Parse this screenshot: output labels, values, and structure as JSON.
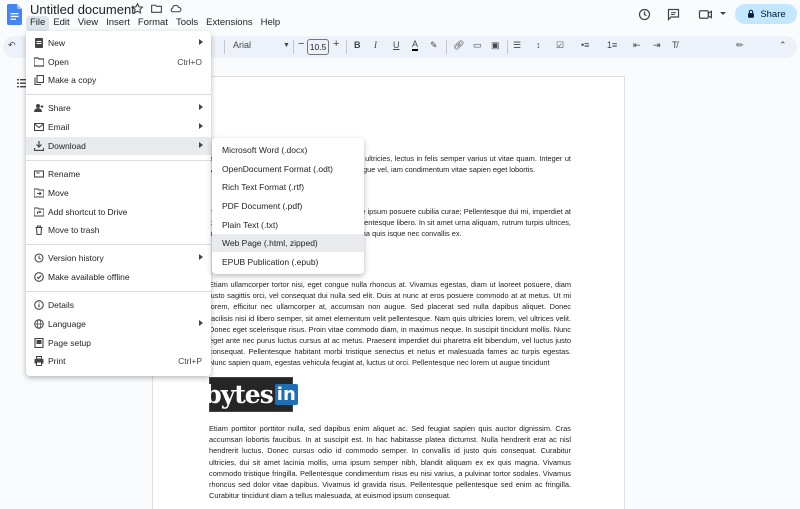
{
  "title": "Untitled document",
  "menu": [
    "File",
    "Edit",
    "View",
    "Insert",
    "Format",
    "Tools",
    "Extensions",
    "Help"
  ],
  "share_label": "Share",
  "toolbar": {
    "font": "Arial",
    "size": "10.5"
  },
  "file_menu": [
    {
      "label": "New",
      "icon": "new-doc-icon",
      "submenu": true,
      "shortcut": ""
    },
    {
      "label": "Open",
      "icon": "folder-icon",
      "submenu": false,
      "shortcut": "Ctrl+O"
    },
    {
      "label": "Make a copy",
      "icon": "copy-icon",
      "submenu": false,
      "shortcut": ""
    },
    {
      "label": "Share",
      "icon": "share-person-icon",
      "submenu": true,
      "shortcut": ""
    },
    {
      "label": "Email",
      "icon": "email-icon",
      "submenu": true,
      "shortcut": ""
    },
    {
      "label": "Download",
      "icon": "download-icon",
      "submenu": true,
      "shortcut": ""
    },
    {
      "label": "Rename",
      "icon": "rename-icon",
      "submenu": false,
      "shortcut": ""
    },
    {
      "label": "Move",
      "icon": "move-icon",
      "submenu": false,
      "shortcut": ""
    },
    {
      "label": "Add shortcut to Drive",
      "icon": "drive-shortcut-icon",
      "submenu": false,
      "shortcut": ""
    },
    {
      "label": "Move to trash",
      "icon": "trash-icon",
      "submenu": false,
      "shortcut": ""
    },
    {
      "label": "Version history",
      "icon": "history-icon",
      "submenu": true,
      "shortcut": ""
    },
    {
      "label": "Make available offline",
      "icon": "offline-icon",
      "submenu": false,
      "shortcut": ""
    },
    {
      "label": "Details",
      "icon": "info-icon",
      "submenu": false,
      "shortcut": ""
    },
    {
      "label": "Language",
      "icon": "globe-icon",
      "submenu": true,
      "shortcut": ""
    },
    {
      "label": "Page setup",
      "icon": "page-setup-icon",
      "submenu": false,
      "shortcut": ""
    },
    {
      "label": "Print",
      "icon": "print-icon",
      "submenu": false,
      "shortcut": "Ctrl+P"
    }
  ],
  "download_menu": [
    "Microsoft Word (.docx)",
    "OpenDocument Format (.odt)",
    "Rich Text Format (.rtf)",
    "PDF Document (.pdf)",
    "Plain Text (.txt)",
    "Web Page (.html, zipped)",
    "EPUB Publication (.epub)"
  ],
  "doc": {
    "p1": "adipiscing elit. Etiam faucibus massa ac purus ultricies, lectus in felis semper varius ut vitae quam. Integer ut Vestibulum augue risus, vestibulum sit amet augue vel, iam condimentum vitae sapien eget lobortis.",
    "p2": "n, sed efficitur enim accumsan. Vestibulum ante ipsum posuere cubilia curae; Pellentesque dui mi, imperdiet at purus purus, et tempor nibh aliquet ac. Sed pellentesque libero. In sit amet urna aliquam, rutrum turpis ultrices, id tellus ac, viverra laoreet velit. Fusce porta urna quis isque nec convallis ex.",
    "p3": "Etiam ullamcorper tortor nisi, eget congue nulla rhoncus at. Vivamus egestas, diam ut laoreet posuere, diam justo sagittis orci, vel consequat dui nulla sed elit. Duis at nunc at eros posuere commodo at at metus. Ut mi lorem, efficitur nec ullamcorper at, accumsan non augue. Sed placerat sed nulla dapibus aliquet. Donec facilisis nisi id libero semper, sit amet elementum velit pellentesque. Nam quis ultricies lorem, vel ultrices velit. Donec eget scelerisque risus. Proin vitae commodo diam, in maximus neque. In suscipit tincidunt mollis. Nunc eget ante nec purus luctus cursus at ac metus. Praesent imperdiet dui pharetra elit bibendum, vel luctus justo consequat. Pellentesque habitant morbi tristique senectus et netus et malesuada fames ac turpis egestas. Nunc sapien quam, egestas vehicula feugiat at, luctus ut orci. Pellentesque nec lorem ut augue tincidunt",
    "logo_text": "bytes",
    "logo_in": "in",
    "p4": "Etiam porttitor porttitor nulla, sed dapibus enim aliquet ac. Sed feugiat sapien quis auctor dignissim. Cras accumsan lobortis faucibus. In at suscipit est. In hac habitasse platea dictumst. Nulla hendrerit erat ac nisl hendrerit luctus. Donec cursus odio id commodo semper. In convallis id justo quis consequat. Curabitur ultricies, dui sit amet lacinia mollis, urna ipsum semper nibh, blandit aliquam ex ex quis magna. Vivamus commodo tristique fringilla. Pellentesque condimentum risus eu nisi varius, a pulvinar tortor sodales. Vivamus rhoncus sed dolor vitae dapibus. Vivamus id gravida risus. Pellentesque pellentesque sed enim ac fringilla. Curabitur tincidunt diam a tellus malesuada, at euismod ipsum consequat."
  }
}
